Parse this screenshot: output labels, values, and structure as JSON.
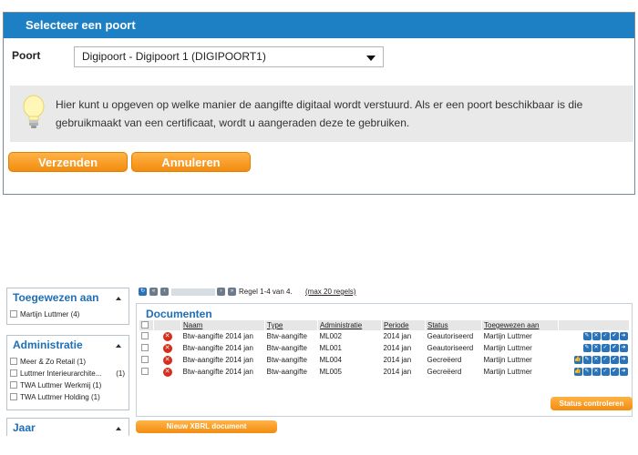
{
  "dialog": {
    "title": "Selecteer een poort",
    "port_label": "Poort",
    "port_value": "Digipoort - Digipoort 1 (DIGIPOORT1)",
    "hint_line1": "Hier kunt u opgeven op welke manier de aangifte digitaal wordt verstuurd. Als er een poort beschikbaar is die",
    "hint_line2": "gebruikmaakt van een certificaat, wordt u aangeraden deze te gebruiken.",
    "send_label": "Verzenden",
    "cancel_label": "Annuleren"
  },
  "filters": {
    "assigned": {
      "title": "Toegewezen aan",
      "items": [
        {
          "label": "Martijn Luttmer (4)"
        }
      ]
    },
    "administration": {
      "title": "Administratie",
      "items": [
        {
          "label": "Meer & Zo Retail (1)",
          "count": ""
        },
        {
          "label": "Luttmer Interieurarchite...",
          "count": "(1)"
        },
        {
          "label": "TWA Luttmer Werkmij (1)",
          "count": ""
        },
        {
          "label": "TWA Luttmer Holding (1)",
          "count": ""
        }
      ]
    },
    "year": {
      "title": "Jaar"
    }
  },
  "pager": {
    "info": "Regel 1-4 van 4.",
    "max": "(max 20 regels)"
  },
  "documents": {
    "heading": "Documenten",
    "columns": [
      "Naam",
      "Type",
      "Administratie",
      "Periode",
      "Status",
      "Toegewezen aan"
    ],
    "rows": [
      {
        "name": "Btw-aangifte 2014 jan",
        "type": "Btw-aangifte",
        "admin": "ML002",
        "period": "2014 jan",
        "status": "Geautoriseerd",
        "assignee": "Martijn Luttmer"
      },
      {
        "name": "Btw-aangifte 2014 jan",
        "type": "Btw-aangifte",
        "admin": "ML001",
        "period": "2014 jan",
        "status": "Geautoriseerd",
        "assignee": "Martijn Luttmer"
      },
      {
        "name": "Btw-aangifte 2014 jan",
        "type": "Btw-aangifte",
        "admin": "ML004",
        "period": "2014 jan",
        "status": "Gecreëerd",
        "assignee": "Martijn Luttmer"
      },
      {
        "name": "Btw-aangifte 2014 jan",
        "type": "Btw-aangifte",
        "admin": "ML005",
        "period": "2014 jan",
        "status": "Gecreëerd",
        "assignee": "Martijn Luttmer"
      }
    ],
    "status_button": "Status controleren",
    "new_button": "Nieuw XBRL document"
  },
  "colors": {
    "accent": "#1d7fc4",
    "button": "#f5a11c",
    "danger": "#d42d1c"
  }
}
